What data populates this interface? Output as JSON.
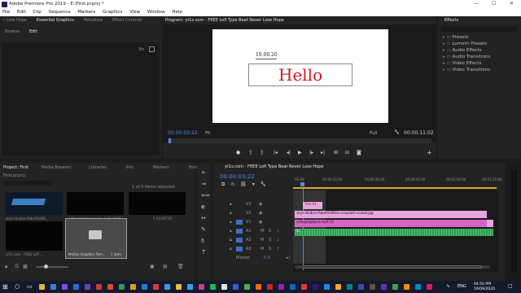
{
  "titlebar": {
    "title": "Adobe Premiere Pro 2019 - E:\\First.prproj *",
    "minimize": "—",
    "maximize": "☐",
    "close": "✕"
  },
  "menu": [
    "File",
    "Edit",
    "Clip",
    "Sequence",
    "Markers",
    "Graphics",
    "View",
    "Window",
    "Help"
  ],
  "top_left_tabs": [
    "» Lore Hope",
    "Essential Graphics",
    "Metadata",
    "Effect Controls"
  ],
  "eg_tabs": [
    "Browse",
    "Edit"
  ],
  "eg_label": "Bo",
  "program": {
    "tab": "Program: yt1s.com - FREE Lofi Type Beat  Never Lose Hope",
    "date_text": "19.09.20",
    "title_text": "Hello",
    "timecode": "00:00:03:22",
    "fit": "Fit",
    "quality": "Full",
    "duration": "00:00:11:02"
  },
  "effects": {
    "tab": "Effects",
    "items": [
      "Presets",
      "Lumetri Presets",
      "Audio Effects",
      "Audio Transitions",
      "Video Effects",
      "Video Transitions"
    ]
  },
  "project": {
    "tabs": [
      "Project: First",
      "Media Browser",
      "Libraries",
      "Info",
      "Markers",
      "History"
    ],
    "file": "First.prproj",
    "count": "1 of 5 items selected",
    "items": [
      {
        "name": "skye-studios-PobnfVsW6...",
        "dur": ""
      },
      {
        "name": "videoplayback.mp4",
        "dur": "1:01:1925"
      },
      {
        "name": "Lofi-Help.png",
        "dur": "5:54:09720"
      },
      {
        "name": "yt1s.com - FREE Lofi ...",
        "dur": "5:54:06"
      },
      {
        "name": "Motion Graphics Tem...",
        "dur": "1 item"
      }
    ]
  },
  "timeline": {
    "tab": "yt1s.com - FREE Lofi Type Beat  Never Lose Hope",
    "timecode": "00:00:03:22",
    "ruler": [
      "00:00",
      "00:00:15:00",
      "00:00:30:00",
      "00:00:45:00",
      "00:01:00:00",
      "00:01:15:00"
    ],
    "tracks": [
      {
        "name": "V3",
        "eye": true
      },
      {
        "name": "V2",
        "eye": true
      },
      {
        "name": "V1",
        "eye": true
      },
      {
        "name": "A1",
        "m": "M",
        "s": "S"
      },
      {
        "name": "A2",
        "m": "M",
        "s": "S"
      },
      {
        "name": "A3",
        "m": "M",
        "s": "S"
      }
    ],
    "master": {
      "label": "Master",
      "value": "0.0"
    },
    "clips": {
      "title": "Title 01",
      "v2": "skye-studios-PobnfVsW6ns-unsplash-scaled.jpg",
      "v1": "videoplayback.mp4 [V]",
      "a1": "fx"
    }
  },
  "taskbar": {
    "lang": "ENG",
    "time": "04:50 PM",
    "date": "19/09/2020"
  },
  "colors": {
    "accent": "#4d8fe5",
    "title_red": "#d01a1a",
    "clip_pink": "#e9a4e0",
    "clip_magenta": "#d964c8",
    "audio_green": "#2e9c52",
    "in_out": "#e0a533"
  }
}
